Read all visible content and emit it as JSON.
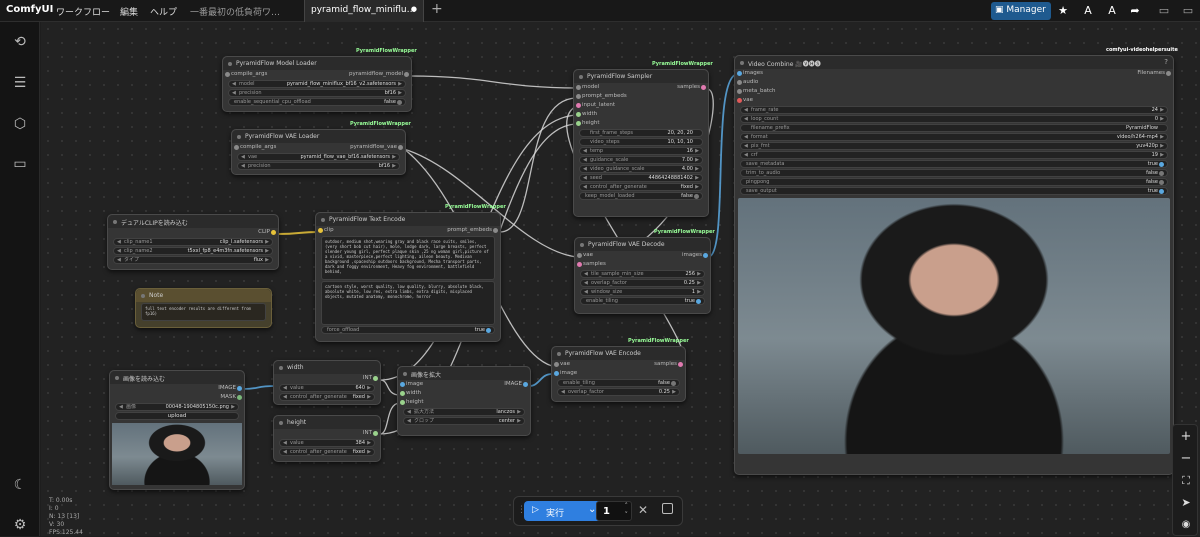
{
  "app": {
    "name": "ComfyUI"
  },
  "menu": [
    "ワークフロー",
    "編集",
    "ヘルプ"
  ],
  "tabs": [
    {
      "label": "一番最初の低負荷ワ…",
      "active": false
    },
    {
      "label": "pyramid_flow_miniflu…",
      "active": true,
      "dot": "●"
    }
  ],
  "topbar": {
    "manager_label": "Manager",
    "new_tab": "+"
  },
  "nodes": {
    "model_loader": {
      "badge": "PyramidFlowWrapper",
      "title": "PyramidFlow Model Loader",
      "in": "compile_args",
      "out": "pyramidflow_model",
      "widgets": [
        [
          "model",
          "pyramid_flow_miniflux_bf16_v2.safetensors"
        ],
        [
          "precision",
          "bf16"
        ],
        [
          "enable_sequential_cpu_offload",
          "false"
        ]
      ]
    },
    "vae_loader": {
      "badge": "PyramidFlowWrapper",
      "title": "PyramidFlow VAE Loader",
      "in": "compile_args",
      "out": "pyramidflow_vae",
      "widgets": [
        [
          "vae",
          "pyramid_flow_vae_bf16.safetensors"
        ],
        [
          "precision",
          "bf16"
        ]
      ]
    },
    "clip": {
      "title": "デュアルCLIPを読み込む",
      "out": "CLIP",
      "widgets": [
        [
          "clip_name1",
          "clip_l.safetensors"
        ],
        [
          "clip_name2",
          "t5xxl_fp8_e4m3fn.safetensors"
        ],
        [
          "タイプ",
          "flux"
        ]
      ]
    },
    "note": {
      "title": "Note",
      "text": "full text encoder results are different from fp16)"
    },
    "text_encode": {
      "badge": "PyramidFlowWrapper",
      "title": "PyramidFlow Text Encode",
      "in": "clip",
      "out": "prompt_embeds",
      "positive": "outdoor, medium shot,wearing gray and black race suits, smiles, (very short bob cut hair), mole, lodge dark, large breasts, perfect slender young girl, perfect plaque skin ,25 ng woman girl,picture of a vivid, masterpiece,perfect lighting, aileon beauty. Medivan background ,spaceship outdoors background, Mecha transport parts, dark and foggy environment, Heavy fog environment, battlefield behind,",
      "negative": "cartoon style, worst quality, low quality, blurry, absolute black, absolute white, low res, extra limbs, extra digits, misplaced objects, mutated anatomy, monochrome, horror",
      "widgets": [
        [
          "force_offload",
          "true"
        ]
      ]
    },
    "sampler": {
      "badge": "PyramidFlowWrapper",
      "title": "PyramidFlow Sampler",
      "inputs": [
        "model",
        "prompt_embeds",
        "input_latent",
        "width",
        "height"
      ],
      "out": "samples",
      "widgets": [
        [
          "first_frame_steps",
          "20, 20, 20"
        ],
        [
          "video_steps",
          "10, 10, 10"
        ],
        [
          "temp",
          "16"
        ],
        [
          "guidance_scale",
          "7.00"
        ],
        [
          "video_guidance_scale",
          "4.00"
        ],
        [
          "seed",
          "44864248881402"
        ],
        [
          "control_after_generate",
          "fixed"
        ],
        [
          "keep_model_loaded",
          "false"
        ]
      ]
    },
    "decode": {
      "badge": "PyramidFlowWrapper",
      "title": "PyramidFlow VAE Decode",
      "inputs": [
        "vae",
        "samples"
      ],
      "out": "images",
      "widgets": [
        [
          "tile_sample_min_size",
          "256"
        ],
        [
          "overlap_factor",
          "0.25"
        ],
        [
          "window_size",
          "1"
        ],
        [
          "enable_tiling",
          "true"
        ]
      ]
    },
    "vae_encode": {
      "badge": "PyramidFlowWrapper",
      "title": "PyramidFlow VAE Encode",
      "inputs": [
        "vae",
        "image"
      ],
      "out": "samples",
      "widgets": [
        [
          "enable_tiling",
          "false"
        ],
        [
          "overlap_factor",
          "0.25"
        ]
      ]
    },
    "video_combine": {
      "badge": "comfyui-videohelpersuite",
      "title": "Video Combine 🎥🅥🅗🅢",
      "inputs": [
        "images",
        "audio",
        "meta_batch",
        "vae"
      ],
      "out": "Filenames",
      "widgets": [
        [
          "frame_rate",
          "24"
        ],
        [
          "loop_count",
          "0"
        ],
        [
          "filename_prefix",
          "PyramidFlow"
        ],
        [
          "format",
          "video/h264-mp4"
        ],
        [
          "pix_fmt",
          "yuv420p"
        ],
        [
          "crf",
          "19"
        ],
        [
          "save_metadata",
          "true"
        ],
        [
          "trim_to_audio",
          "false"
        ],
        [
          "pingpong",
          "false"
        ],
        [
          "save_output",
          "true"
        ]
      ]
    },
    "load_image": {
      "title": "画像を読み込む",
      "outs": [
        "IMAGE",
        "MASK"
      ],
      "widgets": [
        [
          "画像",
          "00048-1904805150c.png"
        ]
      ],
      "upload": "upload"
    },
    "width": {
      "title": "width",
      "out": "INT",
      "widgets": [
        [
          "value",
          "640"
        ],
        [
          "control_after_generate",
          "fixed"
        ]
      ]
    },
    "height": {
      "title": "height",
      "out": "INT",
      "widgets": [
        [
          "value",
          "384"
        ],
        [
          "control_after_generate",
          "fixed"
        ]
      ]
    },
    "upscale": {
      "title": "画像を拡大",
      "inputs": [
        "image",
        "width",
        "height"
      ],
      "out": "IMAGE",
      "widgets": [
        [
          "拡大方法",
          "lanczos"
        ],
        [
          "クロップ",
          "center"
        ]
      ]
    }
  },
  "runbar": {
    "run_label": "実行",
    "batch_count": "1"
  },
  "stats": [
    "T: 0.00s",
    "I: 0",
    "N: 13 [13]",
    "V: 30",
    "FPS:125.44"
  ],
  "colors": {
    "link_white": "#d8d8d8",
    "link_yellow": "#e8c33a",
    "link_blue": "#5aa8e0",
    "manager_bg": "#1f5a8f",
    "run_bg": "#2f7fe0"
  },
  "icons": {
    "sidebar": [
      "history-icon",
      "queue-icon",
      "node-library-icon",
      "model-library-icon",
      "theme-toggle-icon",
      "settings-icon"
    ]
  }
}
